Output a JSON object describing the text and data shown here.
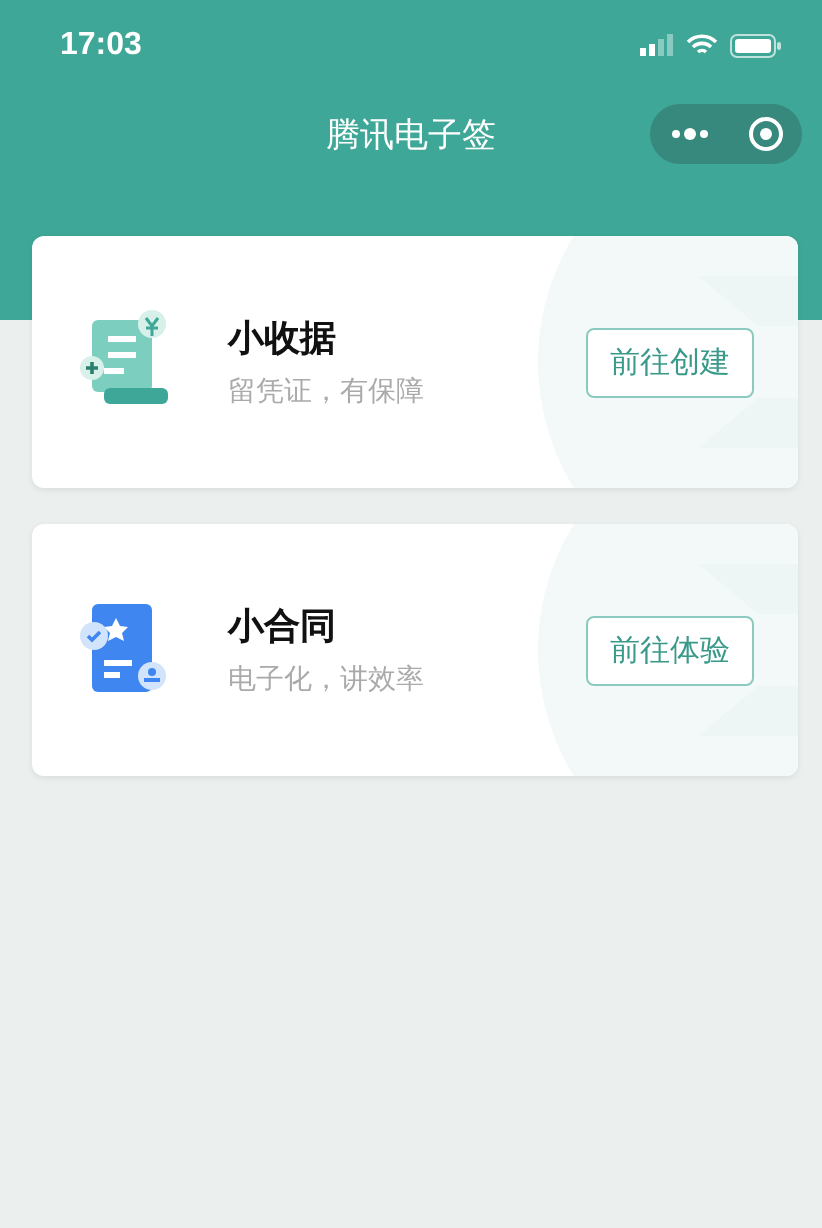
{
  "status_bar": {
    "time": "17:03"
  },
  "nav_bar": {
    "title": "腾讯电子签"
  },
  "cards": [
    {
      "kind": "receipt",
      "title": "小收据",
      "subtitle": "留凭证，有保障",
      "button": "前往创建"
    },
    {
      "kind": "contract",
      "title": "小合同",
      "subtitle": "电子化，讲效率",
      "button": "前往体验"
    }
  ]
}
